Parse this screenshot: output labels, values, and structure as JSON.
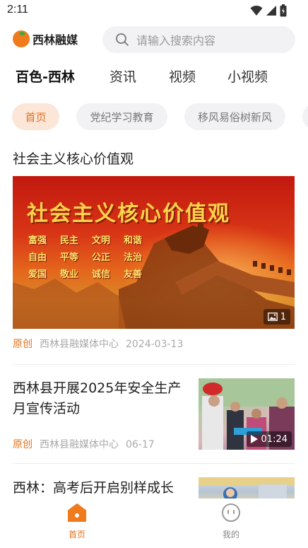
{
  "status_bar": {
    "time": "2:11",
    "icons": [
      "wifi-icon",
      "signal-icon",
      "battery-icon"
    ]
  },
  "header": {
    "logo_text": "西林融媒",
    "search_placeholder": "请输入搜索内容"
  },
  "channels": [
    {
      "label": "百色-西林",
      "active": true
    },
    {
      "label": "资讯",
      "active": false
    },
    {
      "label": "视频",
      "active": false
    },
    {
      "label": "小视频",
      "active": false
    }
  ],
  "categories": [
    {
      "label": "首页",
      "active": true
    },
    {
      "label": "党纪学习教育",
      "active": false
    },
    {
      "label": "移风易俗树新风",
      "active": false
    }
  ],
  "articles": [
    {
      "title": "社会主义核心价值观",
      "banner_headline": "社会主义核心价值观",
      "banner_values": [
        "富强",
        "民主",
        "文明",
        "和谐",
        "自由",
        "平等",
        "公正",
        "法治",
        "爱国",
        "敬业",
        "诚信",
        "友善"
      ],
      "image_count": "1",
      "tag": "原创",
      "source": "西林县融媒体中心",
      "date": "2024-03-13"
    },
    {
      "title": "西林县开展2025年安全生产月宣传活动",
      "duration": "01:24",
      "tag": "原创",
      "source": "西林县融媒体中心",
      "date": "06-17"
    },
    {
      "title": "西林：高考后开启别样成长"
    }
  ],
  "bottom_nav": [
    {
      "label": "首页",
      "icon": "home-icon",
      "active": true
    },
    {
      "label": "我的",
      "icon": "profile-face-icon",
      "active": false
    }
  ],
  "colors": {
    "accent": "#e3711b",
    "pill_active_bg": "#fbe6d8",
    "pill_bg": "#f2f2f5"
  }
}
